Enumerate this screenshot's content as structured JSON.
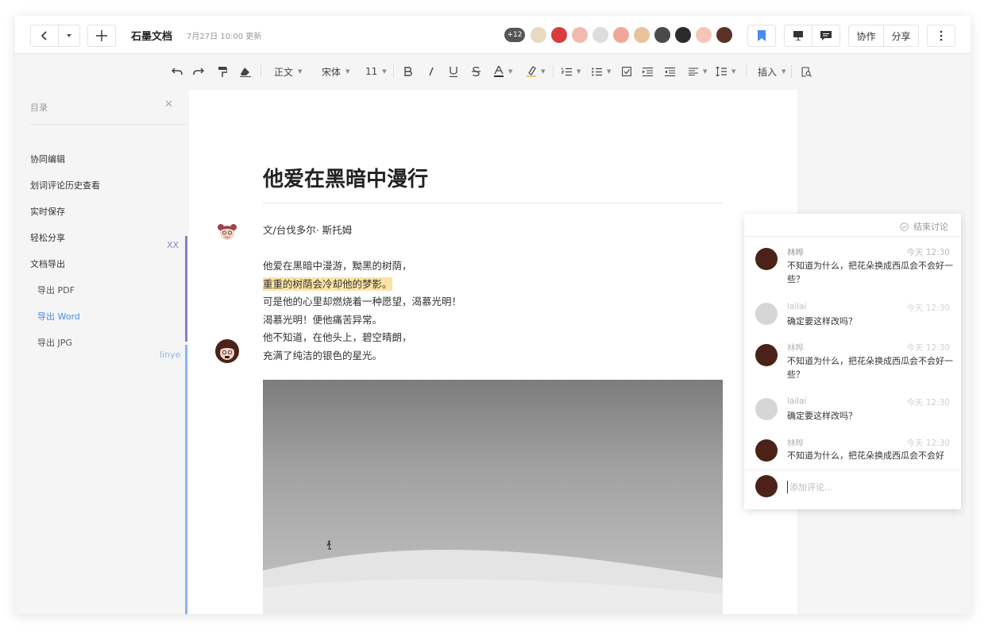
{
  "header": {
    "title": "石墨文档",
    "meta": "7月27日 10:00 更新",
    "more_count": "+12",
    "collab_label": "协作",
    "share_label": "分享",
    "accent": "#4a8be8"
  },
  "toolbar": {
    "style": "正文",
    "font": "宋体",
    "size": "11",
    "insert": "插入"
  },
  "toc": {
    "heading": "目录",
    "items": [
      "协同编辑",
      "划词评论历史查看",
      "实时保存",
      "轻松分享",
      "文档导出"
    ],
    "subitems": [
      "导出 PDF",
      "导出 Word",
      "导出 JPG"
    ],
    "active_sub": 1
  },
  "collaborators": {
    "xx": {
      "name": "XX",
      "color": "#8f7fbf"
    },
    "linye": {
      "name": "linye",
      "color": "#8db4ee"
    }
  },
  "document": {
    "title": "他爱在黑暗中漫行",
    "author": "文/台伐多尔· 斯托姆",
    "lines": [
      "他爱在黑暗中漫游，黝黑的树荫，",
      "重重的树荫会冷却他的梦影。",
      "可是他的心里却燃烧着一种愿望，渴慕光明！",
      "渴慕光明！便他痛苦异常。",
      "他不知道，在他头上，碧空晴朗，",
      "充满了纯洁的银色的星光。"
    ],
    "highlight_index": 1
  },
  "comments": {
    "end_label": "结束讨论",
    "placeholder": "添加评论...",
    "items": [
      {
        "name": "林晔",
        "time": "今天 12:30",
        "text": "不知道为什么，把花朵换成西瓜会不会好一些？"
      },
      {
        "name": "lailai",
        "time": "今天 12:30",
        "text": "确定要这样改吗？"
      },
      {
        "name": "林晔",
        "time": "今天 12:30",
        "text": "不知道为什么，把花朵换成西瓜会不会好一些？"
      },
      {
        "name": "lailai",
        "time": "今天 12:30",
        "text": "确定要这样改吗？"
      },
      {
        "name": "林晔",
        "time": "今天 12:30",
        "text": "不知道为什么，把花朵换成西瓜会不会好"
      }
    ]
  }
}
